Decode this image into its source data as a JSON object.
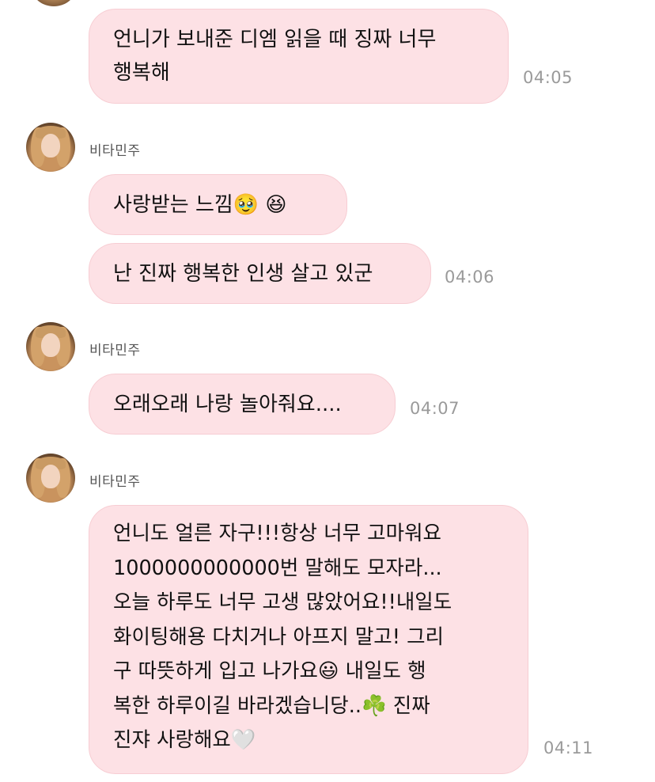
{
  "messages": [
    {
      "text": "언니가 보내준 디엠 읽을 때 징짜 너무\n행복해",
      "time": "04:05"
    },
    {
      "sender": "비타민주",
      "text": "사랑받는 느낌🥹 😆"
    },
    {
      "text": "난 진짜 행복한 인생 살고 있군",
      "time": "04:06"
    },
    {
      "sender": "비타민주",
      "text": "오래오래 나랑 놀아줘요....",
      "time": "04:07"
    },
    {
      "sender": "비타민주",
      "text": "언니도 얼른 자구!!!항상 너무 고마워요\n1000000000000번 말해도 모자라...\n오늘 하루도 너무 고생 많았어요!!내일도\n화이팅해용 다치거나 아프지 말고! 그리\n구 따뜻하게 입고 나가요😃 내일도 행\n복한 하루이길 바라겠습니당..☘️ 진짜\n진쟈 사랑해요🤍",
      "time": "04:11"
    }
  ],
  "colors": {
    "bubble_bg": "#fde1e5",
    "bubble_border": "#f7cdd3",
    "time_text": "#9a9a9a",
    "name_text": "#555555"
  }
}
